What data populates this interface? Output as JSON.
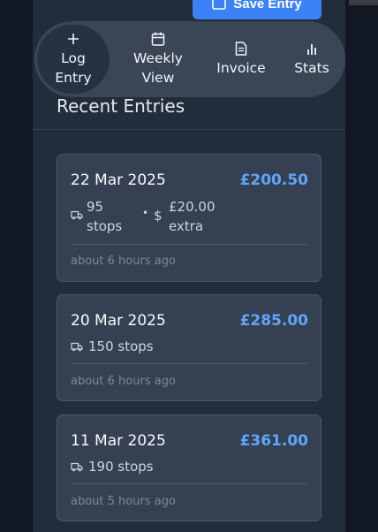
{
  "header": {
    "save_label": "Save Entry"
  },
  "nav": {
    "items": [
      {
        "icon": "plus-icon",
        "line1": "Log",
        "line2": "Entry"
      },
      {
        "icon": "calendar-icon",
        "line1": "Weekly",
        "line2": "View"
      },
      {
        "icon": "document-icon",
        "line1": "Invoice"
      },
      {
        "icon": "bar-chart-icon",
        "line1": "Stats"
      }
    ]
  },
  "recent": {
    "title": "Recent Entries",
    "entries": [
      {
        "date": "22 Mar 2025",
        "amount": "£200.50",
        "stops_count": "95",
        "stops_word": "stops",
        "separator": "•",
        "extra_symbol": "$",
        "extra_amount": "£20.00",
        "extra_word": "extra",
        "ago": "about 6 hours ago"
      },
      {
        "date": "20 Mar 2025",
        "amount": "£285.00",
        "stops": "150 stops",
        "ago": "about 6 hours ago"
      },
      {
        "date": "11 Mar 2025",
        "amount": "£361.00",
        "stops": "190 stops",
        "ago": "about 5 hours ago"
      }
    ]
  }
}
